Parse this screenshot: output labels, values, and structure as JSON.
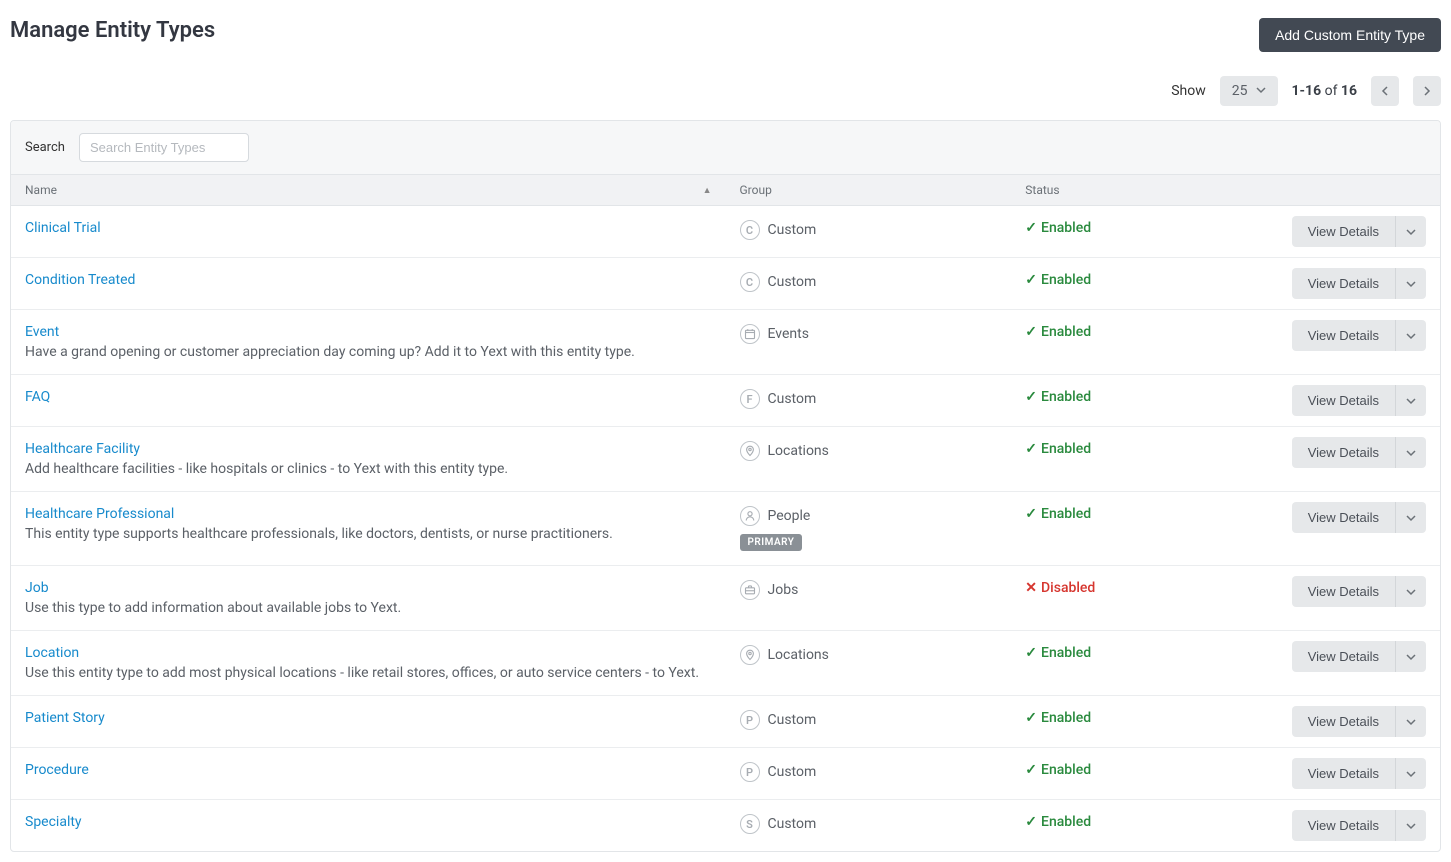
{
  "header": {
    "title": "Manage Entity Types",
    "add_btn": "Add Custom Entity Type"
  },
  "toolbar": {
    "show_label": "Show",
    "page_size": "25",
    "range_start": "1-16",
    "range_sep": " of ",
    "range_total": "16"
  },
  "search": {
    "label": "Search",
    "placeholder": "Search Entity Types"
  },
  "columns": {
    "name": "Name",
    "group": "Group",
    "status": "Status"
  },
  "labels": {
    "view_details": "View Details",
    "primary": "PRIMARY"
  },
  "status_text": {
    "enabled": "Enabled",
    "disabled": "Disabled"
  },
  "rows": [
    {
      "name": "Clinical Trial",
      "desc": "",
      "group": "Custom",
      "group_icon": "C",
      "status": "enabled",
      "primary": false
    },
    {
      "name": "Condition Treated",
      "desc": "",
      "group": "Custom",
      "group_icon": "C",
      "status": "enabled",
      "primary": false
    },
    {
      "name": "Event",
      "desc": "Have a grand opening or customer appreciation day coming up? Add it to Yext with this entity type.",
      "group": "Events",
      "group_icon": "calendar",
      "status": "enabled",
      "primary": false
    },
    {
      "name": "FAQ",
      "desc": "",
      "group": "Custom",
      "group_icon": "F",
      "status": "enabled",
      "primary": false
    },
    {
      "name": "Healthcare Facility",
      "desc": "Add healthcare facilities - like hospitals or clinics - to Yext with this entity type.",
      "group": "Locations",
      "group_icon": "pin",
      "status": "enabled",
      "primary": false
    },
    {
      "name": "Healthcare Professional",
      "desc": "This entity type supports healthcare professionals, like doctors, dentists, or nurse practitioners.",
      "group": "People",
      "group_icon": "person",
      "status": "enabled",
      "primary": true
    },
    {
      "name": "Job",
      "desc": "Use this type to add information about available jobs to Yext.",
      "group": "Jobs",
      "group_icon": "briefcase",
      "status": "disabled",
      "primary": false
    },
    {
      "name": "Location",
      "desc": "Use this entity type to add most physical locations - like retail stores, offices, or auto service centers - to Yext.",
      "group": "Locations",
      "group_icon": "pin",
      "status": "enabled",
      "primary": false
    },
    {
      "name": "Patient Story",
      "desc": "",
      "group": "Custom",
      "group_icon": "P",
      "status": "enabled",
      "primary": false
    },
    {
      "name": "Procedure",
      "desc": "",
      "group": "Custom",
      "group_icon": "P",
      "status": "enabled",
      "primary": false
    },
    {
      "name": "Specialty",
      "desc": "",
      "group": "Custom",
      "group_icon": "S",
      "status": "enabled",
      "primary": false
    }
  ]
}
